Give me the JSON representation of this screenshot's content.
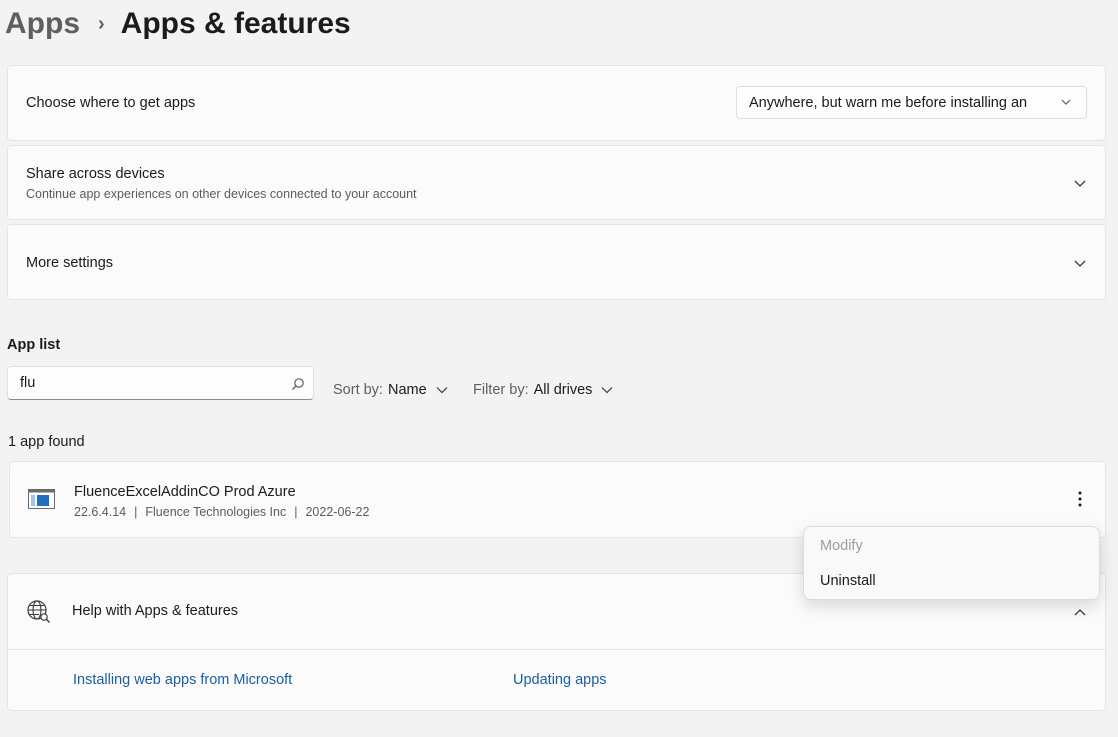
{
  "breadcrumb": {
    "parent": "Apps",
    "separator": "›",
    "current": "Apps & features"
  },
  "settings": {
    "choose_where": {
      "label": "Choose where to get apps",
      "dropdown_value": "Anywhere, but warn me before installing an"
    },
    "share_across": {
      "label": "Share across devices",
      "description": "Continue app experiences on other devices connected to your account"
    },
    "more_settings": {
      "label": "More settings"
    }
  },
  "app_list": {
    "heading": "App list",
    "search_value": "flu",
    "sort": {
      "prefix": "Sort by:",
      "value": "Name"
    },
    "filter": {
      "prefix": "Filter by:",
      "value": "All drives"
    },
    "found_text": "1 app found",
    "apps": [
      {
        "name": "FluenceExcelAddinCO Prod Azure",
        "version": "22.6.4.14",
        "publisher": "Fluence Technologies Inc",
        "date": "2022-06-22",
        "separator": "|"
      }
    ]
  },
  "context_menu": {
    "modify": "Modify",
    "uninstall": "Uninstall"
  },
  "help": {
    "title": "Help with Apps & features",
    "links": [
      "Installing web apps from Microsoft",
      "Updating apps"
    ]
  },
  "icons": {
    "chevron": "chevron-down-icon",
    "search": "search-icon",
    "more": "more-vertical-icon",
    "globe": "globe-search-icon",
    "app": "app-window-icon"
  },
  "colors": {
    "accent_link": "#1a5fa0",
    "app_icon_blue": "#1f6fbf"
  }
}
